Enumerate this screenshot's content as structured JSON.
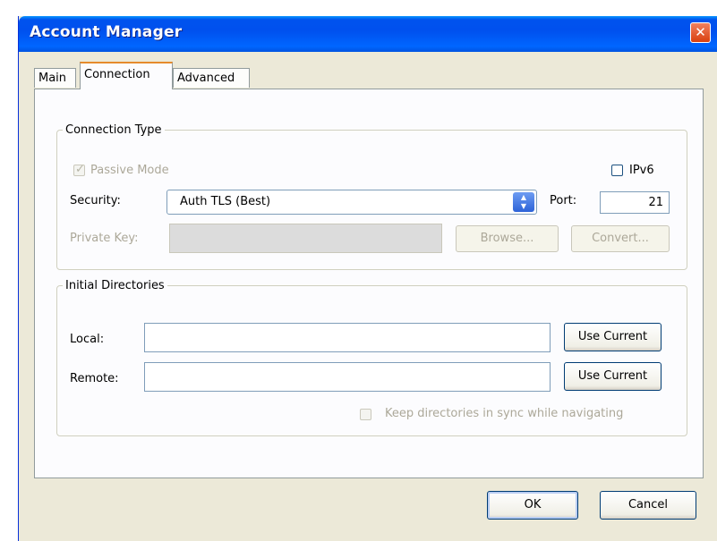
{
  "window": {
    "title": "Account Manager",
    "close_glyph": "✕"
  },
  "tabs": [
    {
      "label": "Main"
    },
    {
      "label": "Connection"
    },
    {
      "label": "Advanced"
    }
  ],
  "connection_type": {
    "legend": "Connection Type",
    "passive_mode": {
      "label": "Passive Mode",
      "checked": true,
      "enabled": false
    },
    "ipv6": {
      "label": "IPv6",
      "checked": false
    },
    "security": {
      "label": "Security:",
      "value": "Auth TLS (Best)"
    },
    "port": {
      "label": "Port:",
      "value": "21"
    },
    "private_key": {
      "label": "Private Key:",
      "value": ""
    },
    "browse_label": "Browse...",
    "convert_label": "Convert..."
  },
  "initial_directories": {
    "legend": "Initial Directories",
    "local": {
      "label": "Local:",
      "value": "",
      "button": "Use Current"
    },
    "remote": {
      "label": "Remote:",
      "value": "",
      "button": "Use Current"
    },
    "keep_sync": {
      "label": "Keep directories in sync while navigating",
      "checked": false,
      "enabled": false
    }
  },
  "footer": {
    "ok_label": "OK",
    "cancel_label": "Cancel"
  },
  "icons": {
    "close": "close-icon",
    "check": "checkmark-icon",
    "spinner": "dropdown-arrow-icon"
  },
  "colors": {
    "titlebar": "#0054e3",
    "accent_tab": "#e68b2c",
    "window_bg": "#ece9d8",
    "close_red": "#e2532d"
  }
}
